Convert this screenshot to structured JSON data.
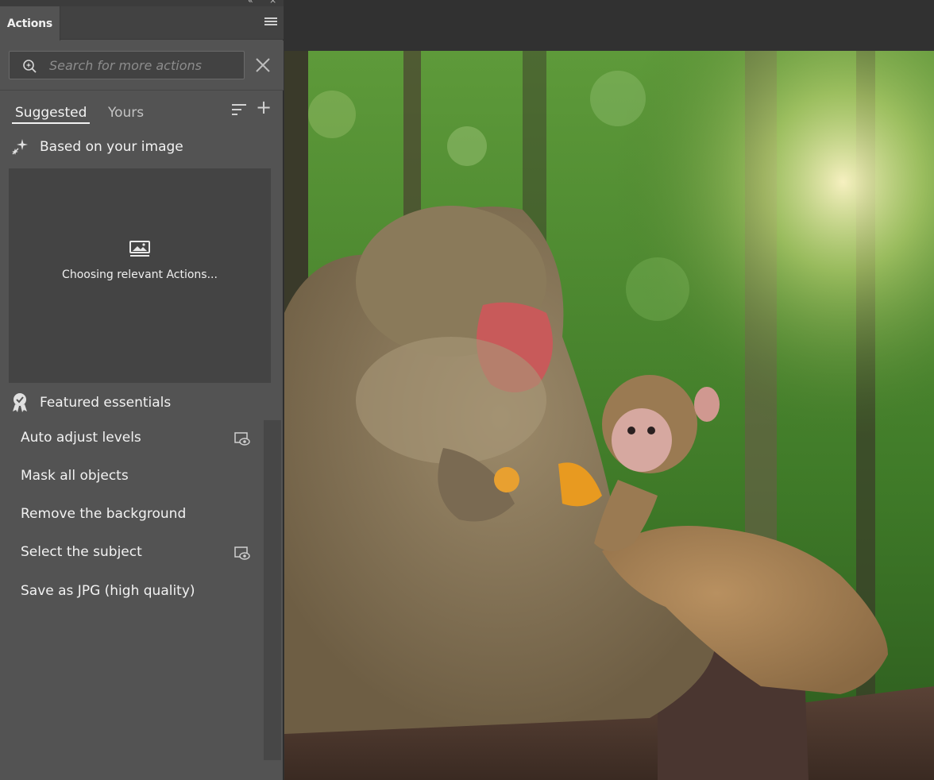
{
  "panel": {
    "title": "Actions",
    "search": {
      "placeholder": "Search for more actions",
      "value": ""
    },
    "tabs": [
      {
        "label": "Suggested",
        "active": true
      },
      {
        "label": "Yours",
        "active": false
      }
    ],
    "suggested_section": {
      "title": "Based on your image",
      "loading_text": "Choosing relevant Actions..."
    },
    "featured_section": {
      "title": "Featured essentials",
      "items": [
        {
          "label": "Auto adjust levels",
          "has_preview": true
        },
        {
          "label": "Mask all objects",
          "has_preview": false
        },
        {
          "label": "Remove the background",
          "has_preview": false
        },
        {
          "label": "Select the subject",
          "has_preview": true
        },
        {
          "label": "Save as JPG (high quality)",
          "has_preview": false
        }
      ]
    },
    "icons": [
      "search-sparkle-icon",
      "close-icon",
      "sort-icon",
      "plus-icon",
      "sparkle-icon",
      "image-loading-icon",
      "badge-icon",
      "preview-eye-icon",
      "panel-menu-icon"
    ]
  },
  "canvas": {
    "image_subject": "photo-of-adult-and-baby-monkey-eating-orange"
  },
  "colors": {
    "panel_bg": "#535353",
    "panel_dark": "#424242",
    "canvas_bg": "#313131",
    "text": "#f2f2f2"
  }
}
